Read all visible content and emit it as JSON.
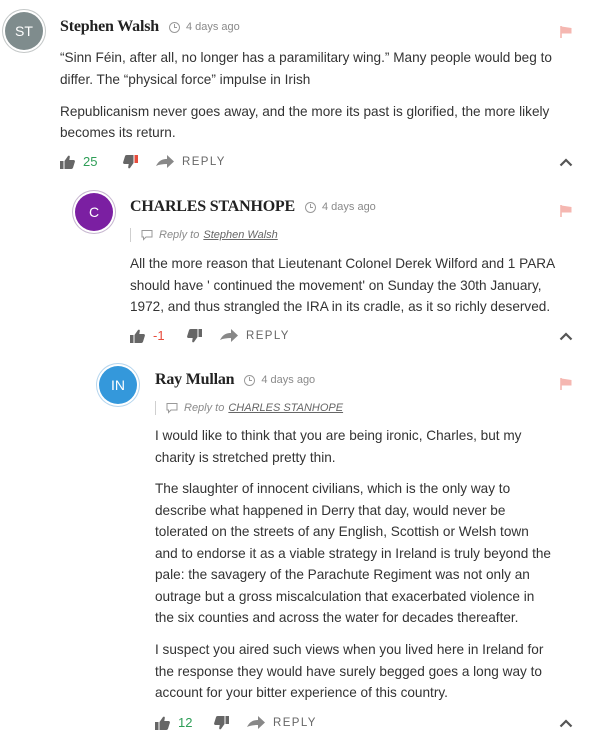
{
  "comments": [
    {
      "author": "Stephen Walsh",
      "avatar_initials": "ST",
      "avatar_color": "#7f8c8d",
      "time": "4 days ago",
      "paragraphs": [
        "“Sinn Féin, after all, no longer has a paramilitary wing.” Many people would beg to",
        "differ. The “physical force” impulse in Irish",
        "Republicanism never goes away, and the more its past is glorified, the more likely",
        "becomes its return."
      ],
      "score": "25",
      "reply_label": "REPLY"
    },
    {
      "author": "CHARLES STANHOPE",
      "avatar_initials": "C",
      "avatar_color": "#7b1fa2",
      "time": "4 days ago",
      "reply_to_label": "Reply to",
      "reply_to_name": "Stephen Walsh",
      "paragraphs": [
        "All the more reason that Lieutenant Colonel Derek Wilford and 1 PARA",
        "should have ' continued the movement' on Sunday the 30th January,",
        "1972, and thus strangled the IRA in its cradle, as it so richly deserved."
      ],
      "score": "-1",
      "reply_label": "REPLY"
    },
    {
      "author": "Ray Mullan",
      "avatar_initials": "IN",
      "avatar_color": "#3498db",
      "time": "4 days ago",
      "reply_to_label": "Reply to",
      "reply_to_name": "CHARLES STANHOPE",
      "paragraphs": [
        "I would like to think that you are being ironic, Charles, but my",
        "charity is stretched pretty thin.",
        "The slaughter of innocent civilians, which is the only way to",
        "describe what happened in Derry that day, would never be",
        "tolerated on the streets of any English, Scottish or Welsh town",
        "and to endorse it as a viable strategy in Ireland is truly beyond the",
        "pale: the savagery of the Parachute Regiment was not only an",
        "outrage but a gross miscalculation that exacerbated violence in",
        "the six counties and across the water for decades thereafter.",
        "I suspect you aired such views when you lived here in Ireland for",
        "the response they would have surely begged goes a long way to",
        "account for your bitter experience of this country."
      ],
      "score": "12",
      "reply_label": "REPLY"
    }
  ],
  "icons": {
    "flag": "flag-icon",
    "clock": "clock-icon",
    "thumbs_up": "thumbs-up-icon",
    "thumbs_down": "thumbs-down-icon",
    "reply": "reply-arrow-icon",
    "collapse": "chevron-up-icon",
    "reply_to": "speech-bubble-icon"
  },
  "colors": {
    "positive_score": "#2e9e57",
    "negative_score": "#e74c3c",
    "flag": "#f5b7b1"
  }
}
